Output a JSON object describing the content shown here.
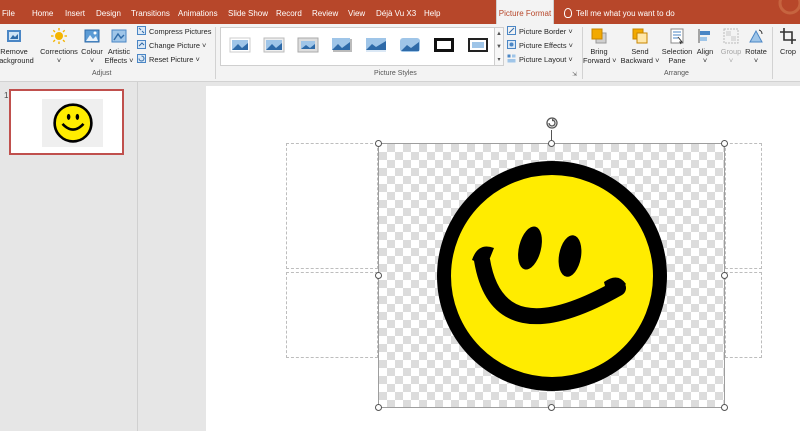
{
  "tabs": [
    {
      "id": "file",
      "label": "File"
    },
    {
      "id": "home",
      "label": "Home"
    },
    {
      "id": "insert",
      "label": "Insert"
    },
    {
      "id": "design",
      "label": "Design"
    },
    {
      "id": "transitions",
      "label": "Transitions"
    },
    {
      "id": "animations",
      "label": "Animations"
    },
    {
      "id": "slideshow",
      "label": "Slide Show"
    },
    {
      "id": "record",
      "label": "Record"
    },
    {
      "id": "review",
      "label": "Review"
    },
    {
      "id": "view",
      "label": "View"
    },
    {
      "id": "dejavu",
      "label": "Déjà Vu X3"
    },
    {
      "id": "help",
      "label": "Help"
    },
    {
      "id": "pictureformat",
      "label": "Picture Format",
      "active": true
    }
  ],
  "tell_me": "Tell me what you want to do",
  "ribbon": {
    "adjust": {
      "remove_bg_1": "Remove",
      "remove_bg_2": "Background",
      "corrections": "Corrections",
      "colour": "Colour",
      "artistic_1": "Artistic",
      "artistic_2": "Effects",
      "compress": "Compress Pictures",
      "change": "Change Picture",
      "reset": "Reset Picture",
      "label": "Adjust"
    },
    "styles": {
      "label": "Picture Styles",
      "border": "Picture Border",
      "effects": "Picture Effects",
      "layout": "Picture Layout"
    },
    "arrange": {
      "bring_1": "Bring",
      "bring_2": "Forward",
      "send_1": "Send",
      "send_2": "Backward",
      "selection_1": "Selection",
      "selection_2": "Pane",
      "align": "Align",
      "group": "Group",
      "rotate": "Rotate",
      "label": "Arrange"
    },
    "size": {
      "crop": "Crop"
    }
  },
  "slides": [
    {
      "number": "1"
    }
  ],
  "colors": {
    "accent": "#b7472a",
    "smiley_fill": "#ffec00",
    "smiley_outline": "#000000"
  }
}
